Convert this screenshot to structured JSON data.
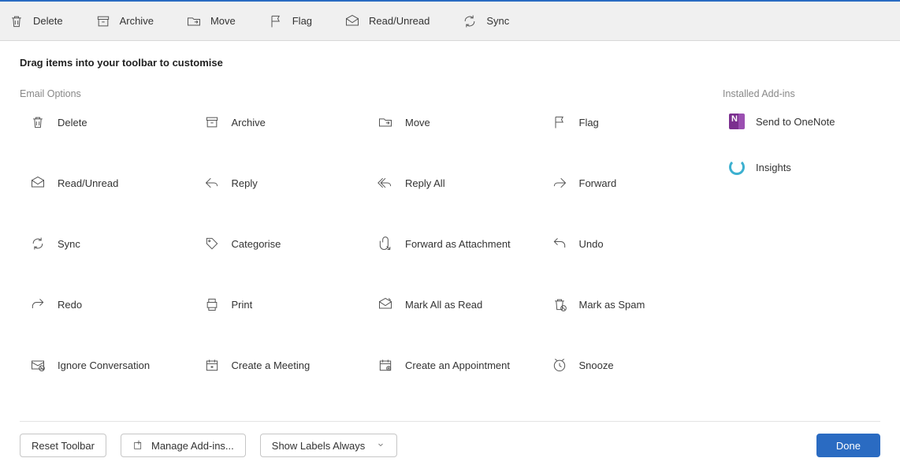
{
  "toolbar": {
    "items": [
      {
        "label": "Delete",
        "iconName": "delete-icon"
      },
      {
        "label": "Archive",
        "iconName": "archive-icon"
      },
      {
        "label": "Move",
        "iconName": "move-icon"
      },
      {
        "label": "Flag",
        "iconName": "flag-icon"
      },
      {
        "label": "Read/Unread",
        "iconName": "read-unread-icon"
      },
      {
        "label": "Sync",
        "iconName": "sync-icon"
      }
    ]
  },
  "instruction": "Drag items into your toolbar to customise",
  "sections": {
    "emailOptionsHeader": "Email Options",
    "installedAddinsHeader": "Installed Add-ins"
  },
  "emailOptions": [
    {
      "label": "Delete",
      "iconName": "delete-icon"
    },
    {
      "label": "Archive",
      "iconName": "archive-icon"
    },
    {
      "label": "Move",
      "iconName": "move-icon"
    },
    {
      "label": "Flag",
      "iconName": "flag-icon"
    },
    {
      "label": "Read/Unread",
      "iconName": "read-unread-icon"
    },
    {
      "label": "Reply",
      "iconName": "reply-icon"
    },
    {
      "label": "Reply All",
      "iconName": "reply-all-icon"
    },
    {
      "label": "Forward",
      "iconName": "forward-icon"
    },
    {
      "label": "Sync",
      "iconName": "sync-icon"
    },
    {
      "label": "Categorise",
      "iconName": "categorise-icon"
    },
    {
      "label": "Forward as Attachment",
      "iconName": "forward-attachment-icon"
    },
    {
      "label": "Undo",
      "iconName": "undo-icon"
    },
    {
      "label": "Redo",
      "iconName": "redo-icon"
    },
    {
      "label": "Print",
      "iconName": "print-icon"
    },
    {
      "label": "Mark All as Read",
      "iconName": "mark-all-read-icon"
    },
    {
      "label": "Mark as Spam",
      "iconName": "mark-spam-icon"
    },
    {
      "label": "Ignore Conversation",
      "iconName": "ignore-conversation-icon"
    },
    {
      "label": "Create a Meeting",
      "iconName": "create-meeting-icon"
    },
    {
      "label": "Create an Appointment",
      "iconName": "create-appointment-icon"
    },
    {
      "label": "Snooze",
      "iconName": "snooze-icon"
    }
  ],
  "addins": [
    {
      "label": "Send to OneNote",
      "iconName": "onenote-icon"
    },
    {
      "label": "Insights",
      "iconName": "insights-icon"
    }
  ],
  "footer": {
    "resetLabel": "Reset Toolbar",
    "manageAddinsLabel": "Manage Add-ins...",
    "showLabelsLabel": "Show Labels Always",
    "doneLabel": "Done"
  }
}
